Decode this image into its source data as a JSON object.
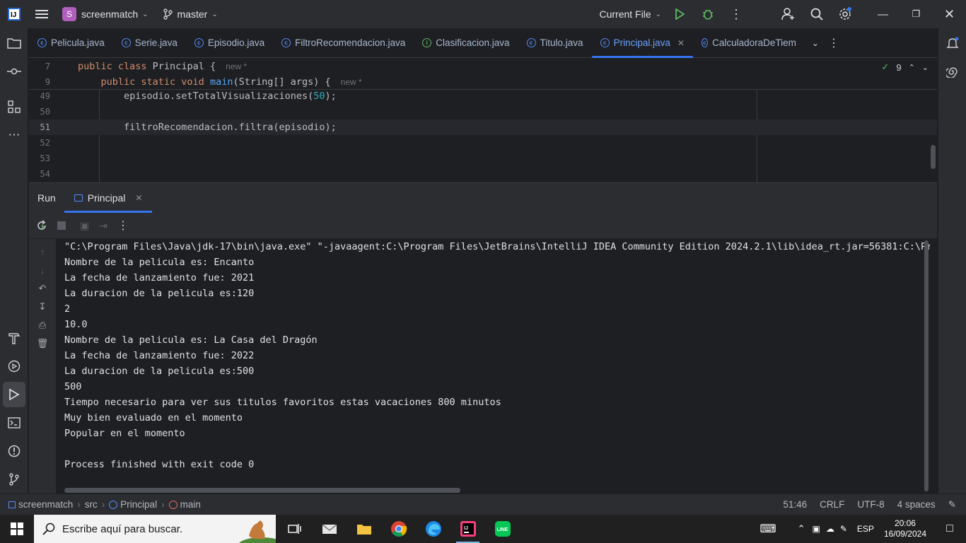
{
  "titlebar": {
    "project_badge": "S",
    "project_name": "screenmatch",
    "branch": "master",
    "run_config": "Current File"
  },
  "tabs": [
    {
      "label": "Pelicula.java"
    },
    {
      "label": "Serie.java"
    },
    {
      "label": "Episodio.java"
    },
    {
      "label": "FiltroRecomendacion.java"
    },
    {
      "label": "Clasificacion.java"
    },
    {
      "label": "Titulo.java"
    },
    {
      "label": "Principal.java"
    },
    {
      "label": "CalculadoraDeTiem"
    }
  ],
  "editor": {
    "problems_count": "9",
    "sticky": [
      {
        "num": "7",
        "kw1": "public class",
        "rest": " Principal {",
        "hint": "new *"
      },
      {
        "num": "9",
        "kw1": "public static void",
        "fn": "main",
        "rest": "(String[] args) {",
        "hint": "new *"
      }
    ],
    "lines": [
      {
        "num": "49",
        "pre": "        episodio.setTotalVisualizaciones(",
        "num_lit": "50",
        "post": ");"
      },
      {
        "num": "50",
        "text": ""
      },
      {
        "num": "51",
        "text": "        filtroRecomendacion.filtra(episodio);"
      },
      {
        "num": "52",
        "text": ""
      },
      {
        "num": "53",
        "text": ""
      },
      {
        "num": "54",
        "text": ""
      }
    ]
  },
  "run": {
    "title": "Run",
    "tab_label": "Principal",
    "console": [
      "\"C:\\Program Files\\Java\\jdk-17\\bin\\java.exe\" \"-javaagent:C:\\Program Files\\JetBrains\\IntelliJ IDEA Community Edition 2024.2.1\\lib\\idea_rt.jar=56381:C:\\Progra",
      "Nombre de la pelicula es: Encanto",
      "La fecha de lanzamiento fue: 2021",
      "La duracion de la pelicula es:120",
      "2",
      "10.0",
      "Nombre de la pelicula es: La Casa del Dragón",
      "La fecha de lanzamiento fue: 2022",
      "La duracion de la pelicula es:500",
      "500",
      "Tiempo necesario para ver sus titulos favoritos estas vacaciones 800 minutos",
      "Muy bien evaluado en el momento",
      "Popular en el momento",
      "",
      "Process finished with exit code 0"
    ]
  },
  "statusbar": {
    "breadcrumb": [
      "screenmatch",
      "src",
      "Principal",
      "main"
    ],
    "position": "51:46",
    "line_sep": "CRLF",
    "encoding": "UTF-8",
    "indent": "4 spaces"
  },
  "taskbar": {
    "search_placeholder": "Escribe aquí para buscar.",
    "lang": "ESP",
    "time": "20:06",
    "date": "16/09/2024"
  },
  "colors": {
    "accent": "#3574f0",
    "bg": "#1e1f22",
    "panel": "#2b2d30"
  }
}
